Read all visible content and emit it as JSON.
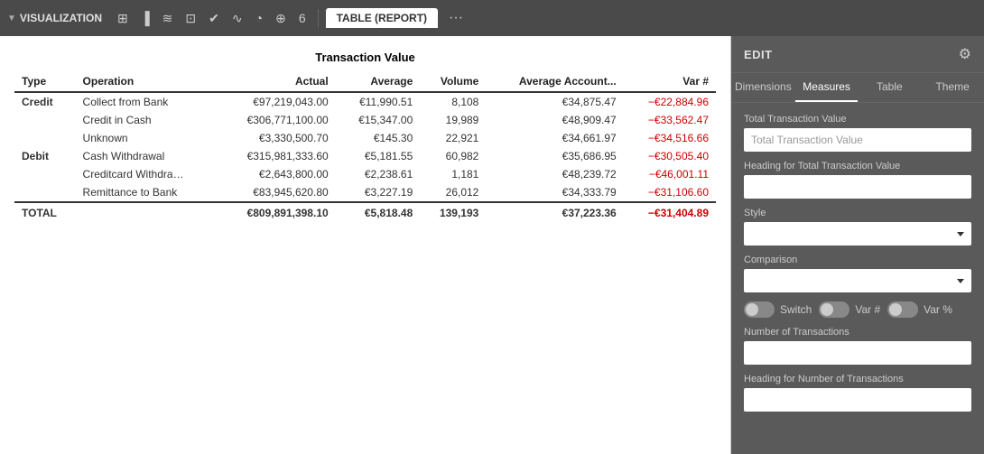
{
  "toolbar": {
    "title": "VISUALIZATION",
    "active_tab_label": "TABLE (REPORT)",
    "more_icon": "···",
    "icons": [
      "grid-icon",
      "bar-icon",
      "line-icon",
      "pivot-icon",
      "check-icon",
      "area-icon",
      "pie-icon",
      "map-icon",
      "number-icon"
    ]
  },
  "table": {
    "title": "Transaction Value",
    "headers": [
      "Type",
      "Operation",
      "Actual",
      "Average",
      "Volume",
      "Average Account...",
      "Var #"
    ],
    "groups": [
      {
        "type": "Credit",
        "rows": [
          {
            "operation": "Collect from Bank",
            "actual": "€97,219,043.00",
            "average": "€11,990.51",
            "volume": "8,108",
            "avg_account": "€34,875.47",
            "var": "−€22,884.96"
          },
          {
            "operation": "Credit in Cash",
            "actual": "€306,771,100.00",
            "average": "€15,347.00",
            "volume": "19,989",
            "avg_account": "€48,909.47",
            "var": "−€33,562.47"
          },
          {
            "operation": "Unknown",
            "actual": "€3,330,500.70",
            "average": "€145.30",
            "volume": "22,921",
            "avg_account": "€34,661.97",
            "var": "−€34,516.66"
          }
        ]
      },
      {
        "type": "Debit",
        "rows": [
          {
            "operation": "Cash Withdrawal",
            "actual": "€315,981,333.60",
            "average": "€5,181.55",
            "volume": "60,982",
            "avg_account": "€35,686.95",
            "var": "−€30,505.40"
          },
          {
            "operation": "Creditcard Withdra…",
            "actual": "€2,643,800.00",
            "average": "€2,238.61",
            "volume": "1,181",
            "avg_account": "€48,239.72",
            "var": "−€46,001.11"
          },
          {
            "operation": "Remittance to Bank",
            "actual": "€83,945,620.80",
            "average": "€3,227.19",
            "volume": "26,012",
            "avg_account": "€34,333.79",
            "var": "−€31,106.60"
          }
        ]
      }
    ],
    "total_row": {
      "label": "TOTAL",
      "actual": "€809,891,398.10",
      "average": "€5,818.48",
      "volume": "139,193",
      "avg_account": "€37,223.36",
      "var": "−€31,404.89"
    }
  },
  "edit_panel": {
    "title": "EDIT",
    "gear_icon": "⚙",
    "tabs": [
      "Dimensions",
      "Measures",
      "Table",
      "Theme"
    ],
    "active_tab": "Measures",
    "sections": [
      {
        "label": "Total Transaction Value",
        "input_placeholder": "Total Transaction Value",
        "input_value": ""
      },
      {
        "label": "Heading for Total Transaction Value",
        "input_placeholder": "",
        "input_value": ""
      },
      {
        "label": "Style",
        "type": "select"
      },
      {
        "label": "Comparison",
        "type": "select"
      },
      {
        "label": "Number of Transactions",
        "input_placeholder": "",
        "input_value": ""
      },
      {
        "label": "Heading for Number of Transactions",
        "input_placeholder": "",
        "input_value": ""
      }
    ],
    "toggles": [
      {
        "label": "Switch"
      },
      {
        "label": "Var #"
      },
      {
        "label": "Var %"
      }
    ]
  }
}
